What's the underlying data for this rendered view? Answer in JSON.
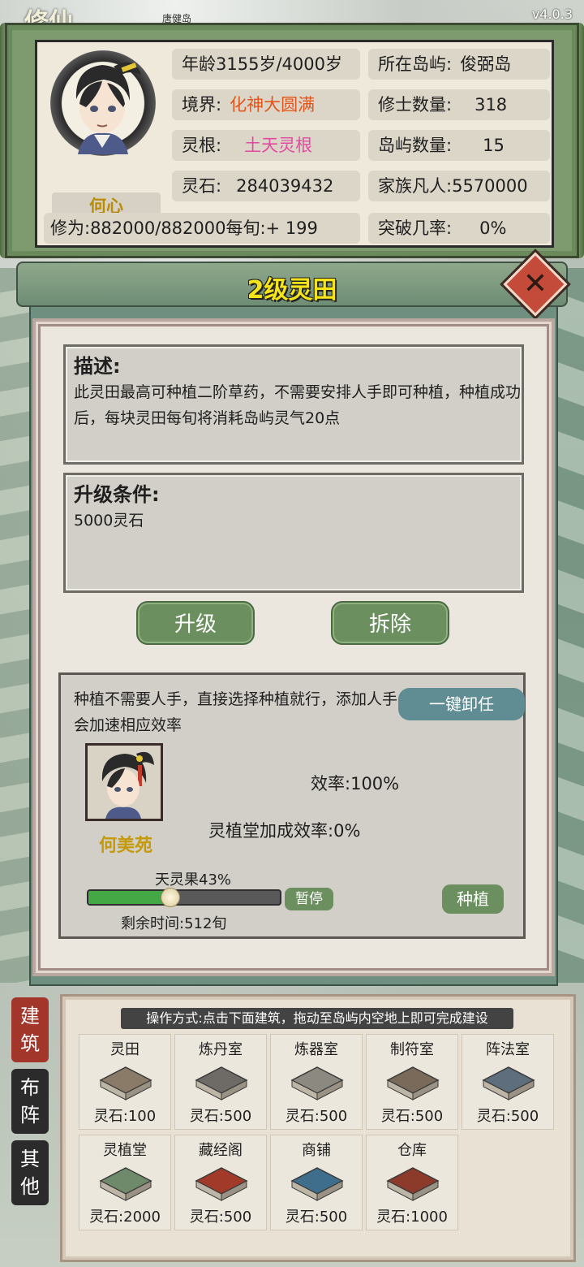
{
  "header": {
    "game_title": "修仙",
    "version": "v4.0.3",
    "island_tag": "唐健岛"
  },
  "character": {
    "name": "何心",
    "age_label": "年龄3155岁/4000岁",
    "realm_label": "境界:",
    "realm_value": "化神大圆满",
    "root_label": "灵根:",
    "root_value": "土天灵根",
    "stone_label": "灵石:",
    "stone_value": "284039432",
    "cultivation_label": "修为:882000/882000每旬:+ 199",
    "island_label": "所在岛屿:",
    "island_value": "俊弼岛",
    "cultivator_count_label": "修士数量:",
    "cultivator_count_value": "318",
    "island_count_label": "岛屿数量:",
    "island_count_value": "15",
    "family_label": "家族凡人:",
    "family_value": "5570000",
    "breakthrough_label": "突破几率:",
    "breakthrough_value": "0%"
  },
  "building": {
    "title": "2级灵田",
    "close_icon": "close-x-icon",
    "description_title": "描述:",
    "description_text": "此灵田最高可种植二阶草药，不需要安排人手即可种植，种植成功后，每块灵田每旬将消耗岛屿灵气20点",
    "upgrade_title": "升级条件:",
    "upgrade_text": "5000灵石",
    "upgrade_button": "升级",
    "demolish_button": "拆除"
  },
  "worker": {
    "info_text": "种植不需要人手，直接选择种植就行，添加人手会加速相应效率",
    "dismiss_button": "一键卸任",
    "name": "何美苑",
    "efficiency_label": "效率:",
    "efficiency_value": "100%",
    "hall_bonus_label": "灵植堂加成效率:",
    "hall_bonus_value": "0%",
    "crop_label": "天灵果43%",
    "progress_fraction": 0.43,
    "pause_button": "暂停",
    "plant_button": "种植",
    "remaining_label": "剩余时间:",
    "remaining_value": "512旬"
  },
  "side_tabs": [
    {
      "label": "建筑"
    },
    {
      "label": "布阵"
    },
    {
      "label": "其他"
    }
  ],
  "build_menu": {
    "instructions": "操作方式:点击下面建筑，拖动至岛屿内空地上即可完成建设",
    "items": [
      {
        "name": "灵田",
        "cost": "灵石:100"
      },
      {
        "name": "炼丹室",
        "cost": "灵石:500"
      },
      {
        "name": "炼器室",
        "cost": "灵石:500"
      },
      {
        "name": "制符室",
        "cost": "灵石:500"
      },
      {
        "name": "阵法室",
        "cost": "灵石:500"
      },
      {
        "name": "灵植堂",
        "cost": "灵石:2000"
      },
      {
        "name": "藏经阁",
        "cost": "灵石:500"
      },
      {
        "name": "商铺",
        "cost": "灵石:500"
      },
      {
        "name": "仓库",
        "cost": "灵石:1000"
      }
    ]
  },
  "colors": {
    "realm": "#e2561b",
    "root": "#e24aa2",
    "title_yellow": "#f5e41a",
    "green_button": "#6b8f5e",
    "teal_button": "#5f8d93",
    "progress_green": "#44a844"
  }
}
